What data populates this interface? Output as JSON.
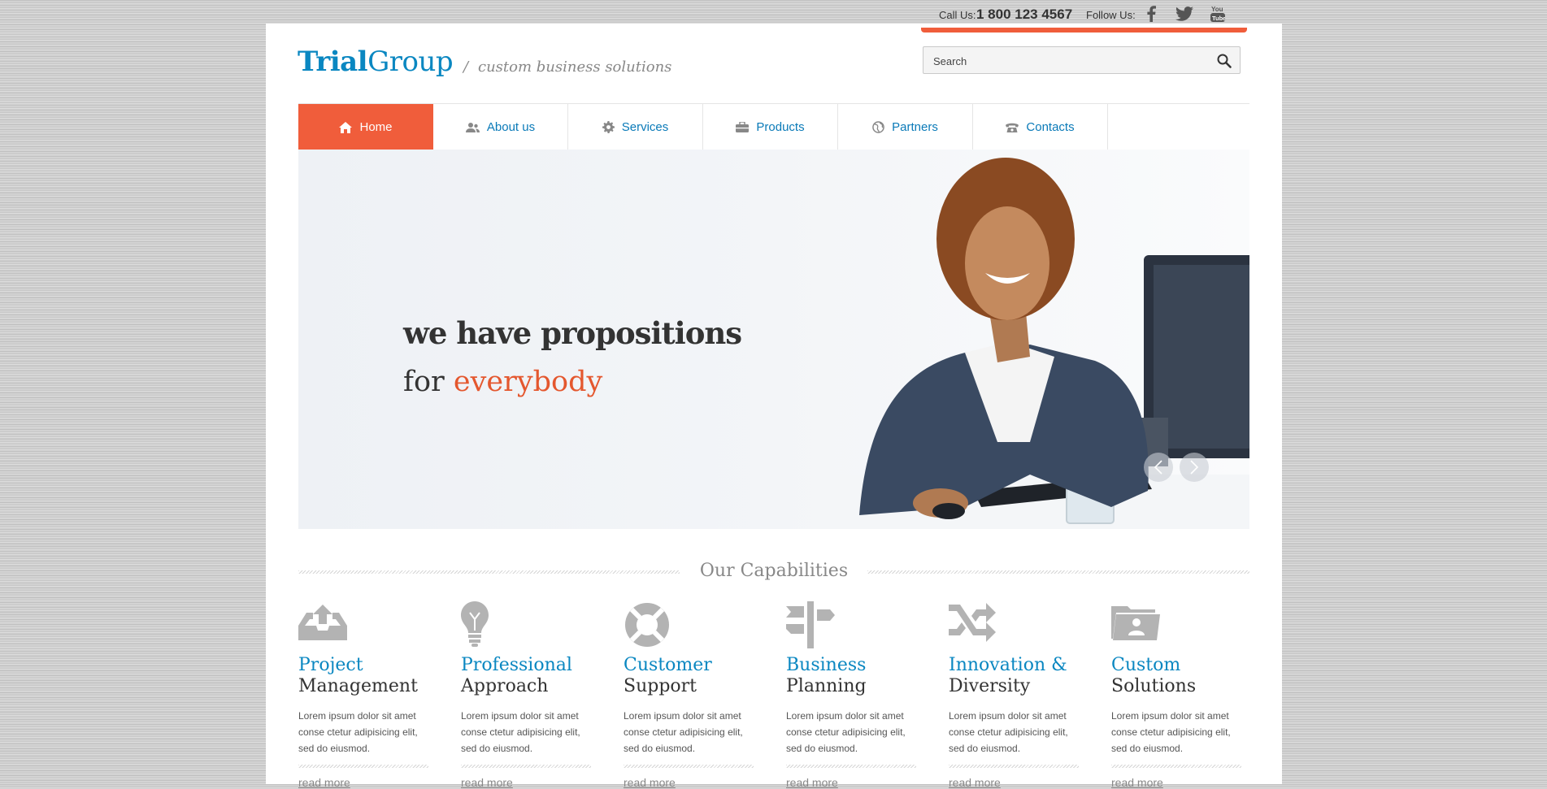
{
  "topbar": {
    "call_label": "Call Us:",
    "phone": "1 800 123 4567",
    "follow_label": "Follow Us:",
    "social": [
      "facebook-icon",
      "twitter-icon",
      "youtube-icon"
    ]
  },
  "header": {
    "logo_part1": "Trial",
    "logo_part2": "Group",
    "slash": "/",
    "tagline": "custom business solutions",
    "search_placeholder": "Search"
  },
  "nav": {
    "items": [
      {
        "label": "Home",
        "icon": "home-icon",
        "active": true
      },
      {
        "label": "About us",
        "icon": "users-icon",
        "active": false
      },
      {
        "label": "Services",
        "icon": "gear-icon",
        "active": false
      },
      {
        "label": "Products",
        "icon": "briefcase-icon",
        "active": false
      },
      {
        "label": "Partners",
        "icon": "globe-icon",
        "active": false
      },
      {
        "label": "Contacts",
        "icon": "phone-icon",
        "active": false
      }
    ]
  },
  "slider": {
    "headline_line1": "we have propositions",
    "headline_line2_a": "for ",
    "headline_line2_b": "everybody"
  },
  "capabilities": {
    "title": "Our Capabilities",
    "items": [
      {
        "t1": "Project",
        "t2": "Management",
        "desc": "Lorem ipsum dolor sit amet conse ctetur adipisicing elit, sed do eiusmod.",
        "more": "read more",
        "icon": "inbox-upload-icon"
      },
      {
        "t1": "Professional",
        "t2": "Approach",
        "desc": "Lorem ipsum dolor sit amet conse ctetur adipisicing elit, sed do eiusmod.",
        "more": "read more",
        "icon": "lightbulb-icon"
      },
      {
        "t1": "Customer",
        "t2": "Support",
        "desc": "Lorem ipsum dolor sit amet conse ctetur adipisicing elit, sed do eiusmod.",
        "more": "read more",
        "icon": "lifebuoy-icon"
      },
      {
        "t1": "Business",
        "t2": "Planning",
        "desc": "Lorem ipsum dolor sit amet conse ctetur adipisicing elit, sed do eiusmod.",
        "more": "read more",
        "icon": "signpost-icon"
      },
      {
        "t1": "Innovation &",
        "t2": "Diversity",
        "desc": "Lorem ipsum dolor sit amet conse ctetur adipisicing elit, sed do eiusmod.",
        "more": "read more",
        "icon": "shuffle-icon"
      },
      {
        "t1": "Custom",
        "t2": "Solutions",
        "desc": "Lorem ipsum dolor sit amet conse ctetur adipisicing elit, sed do eiusmod.",
        "more": "read more",
        "icon": "folder-user-icon"
      }
    ]
  },
  "colors": {
    "accent": "#f05d3b",
    "brand_blue": "#0a87c1"
  }
}
